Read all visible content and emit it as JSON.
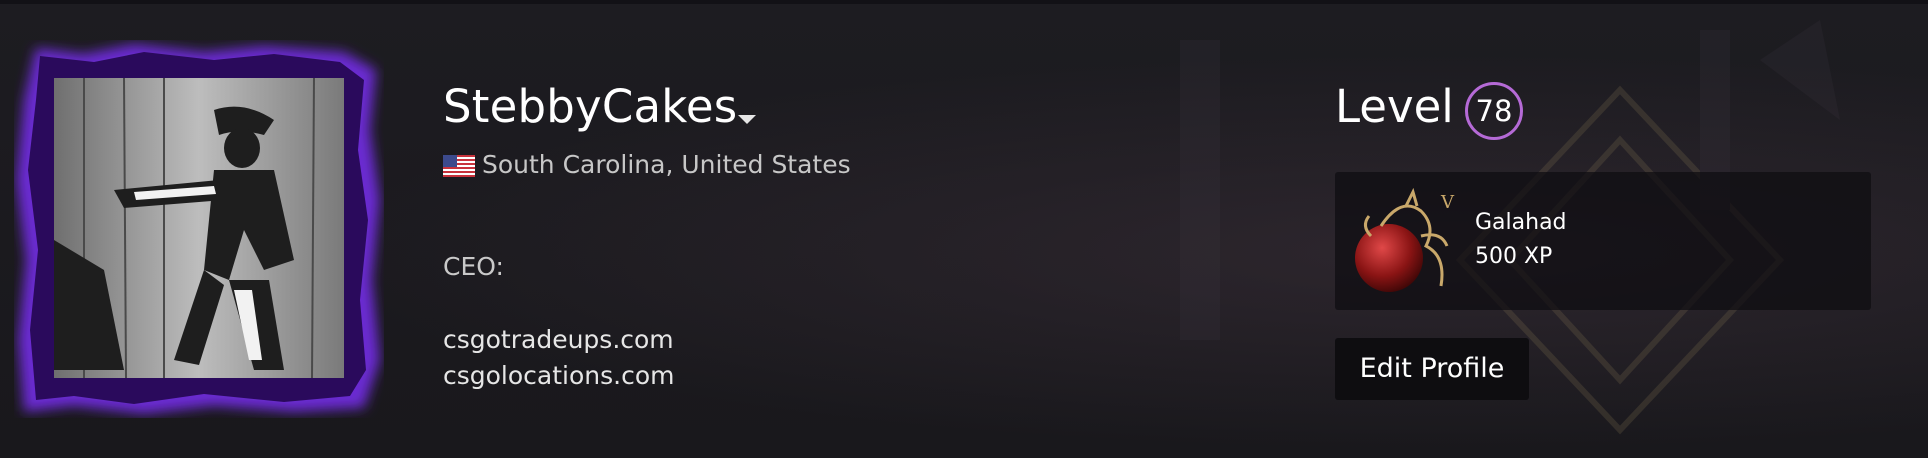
{
  "profile": {
    "persona_name": "StebbyCakes",
    "location": "South Carolina, United States",
    "summary": {
      "heading": "CEO:",
      "lines": [
        "csgotradeups.com",
        "csgolocations.com"
      ]
    }
  },
  "level": {
    "label": "Level",
    "value": "78",
    "ring_color": "#b56ad6"
  },
  "featured_badge": {
    "name": "Galahad",
    "xp": "500 XP",
    "icon": "dragon-on-red-orb-badge"
  },
  "actions": {
    "edit_profile_label": "Edit Profile"
  },
  "icons": {
    "dropdown": "caret-down-icon",
    "flag": "us-flag-icon"
  },
  "colors": {
    "background": "#19181c",
    "avatar_frame": "#5a1fb3",
    "accent": "#b56ad6"
  }
}
